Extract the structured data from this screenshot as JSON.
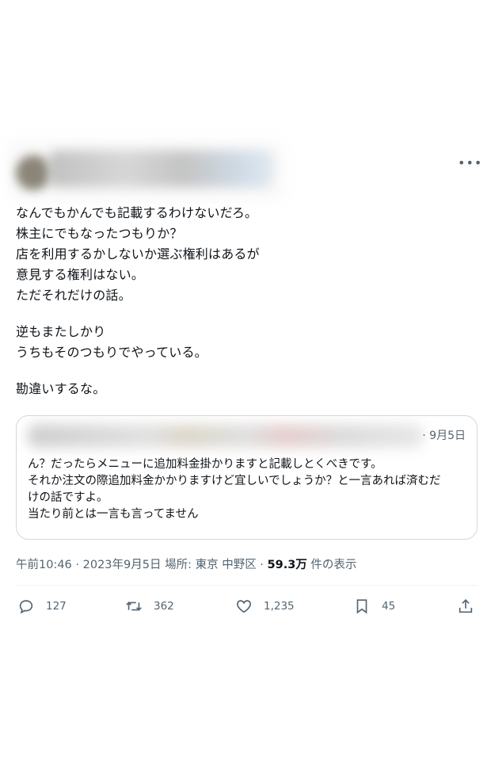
{
  "tweet": {
    "more_icon": "more-horizontal-icon",
    "lines": [
      "なんでもかんでも記載するわけないだろ。",
      "株主にでもなったつもりか？",
      "店を利用するかしないか選ぶ権利はあるが",
      "意見する権利はない。",
      "ただそれだけの話。",
      "逆もまたしかり",
      "うちもそのつもりでやっている。",
      "勘違いするな。"
    ]
  },
  "quote": {
    "date": "· 9月5日",
    "lines": [
      "ん？だったらメニューに追加料金掛かりますと記載しとくべきです。",
      "それか注文の際追加料金かかりますけど宜しいでしょうか？と一言あれば済むだ",
      "けの話ですよ。",
      "当たり前とは一言も言ってません"
    ]
  },
  "meta": {
    "time": "午前10:46",
    "sep1": " · ",
    "date": "2023年9月5日",
    "location": " 場所: 東京 中野区",
    "sep2": " · ",
    "views_count": "59.3万",
    "views_label": " 件の表示"
  },
  "actions": {
    "reply_count": "127",
    "retweet_count": "362",
    "like_count": "1,235",
    "bookmark_count": "45"
  }
}
